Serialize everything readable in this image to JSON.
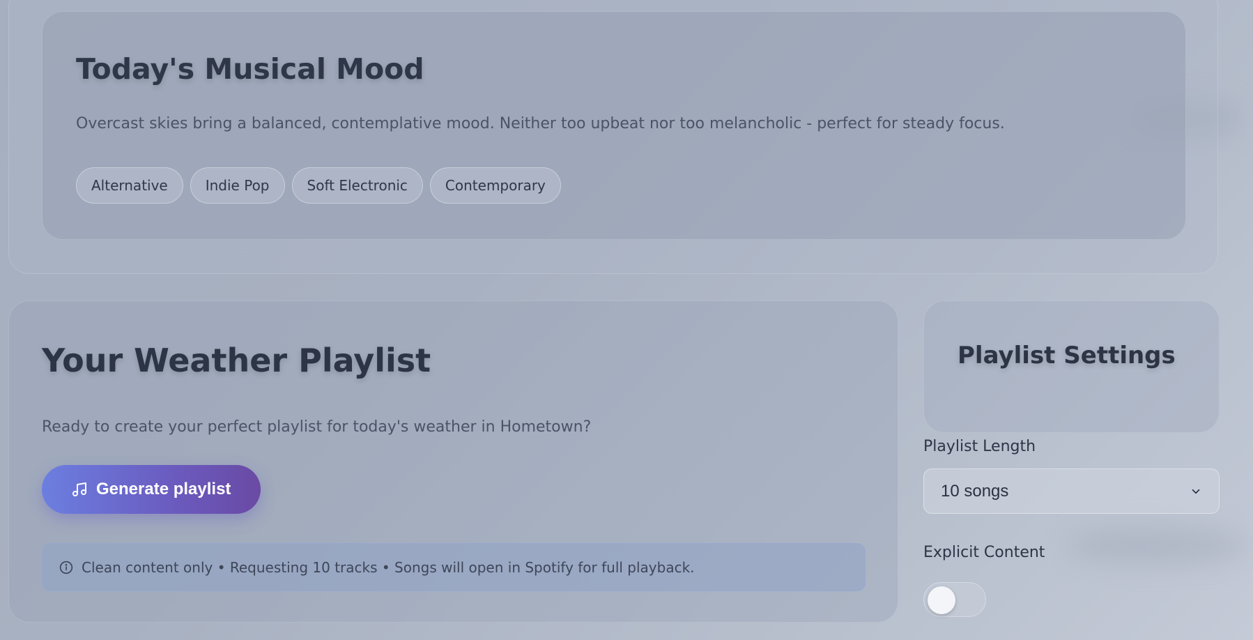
{
  "mood": {
    "title": "Today's Musical Mood",
    "description": "Overcast skies bring a balanced, contemplative mood. Neither too upbeat nor too melancholic - perfect for steady focus.",
    "genres": [
      "Alternative",
      "Indie Pop",
      "Soft Electronic",
      "Contemporary"
    ]
  },
  "playlist": {
    "title": "Your Weather Playlist",
    "description": "Ready to create your perfect playlist for today's weather in Hometown?",
    "generate_button": "Generate playlist",
    "generate_icon": "music-note-icon",
    "info_icon": "info-icon",
    "info": "Clean content only • Requesting 10 tracks • Songs will open in Spotify for full playback."
  },
  "settings": {
    "title": "Playlist Settings",
    "length_label": "Playlist Length",
    "length_value": "10 songs",
    "explicit_label": "Explicit Content",
    "explicit_enabled": false
  },
  "colors": {
    "button_gradient_start": "#6b7fe0",
    "button_gradient_end": "#6a4aa4",
    "info_bar": "#8ca0c8"
  }
}
